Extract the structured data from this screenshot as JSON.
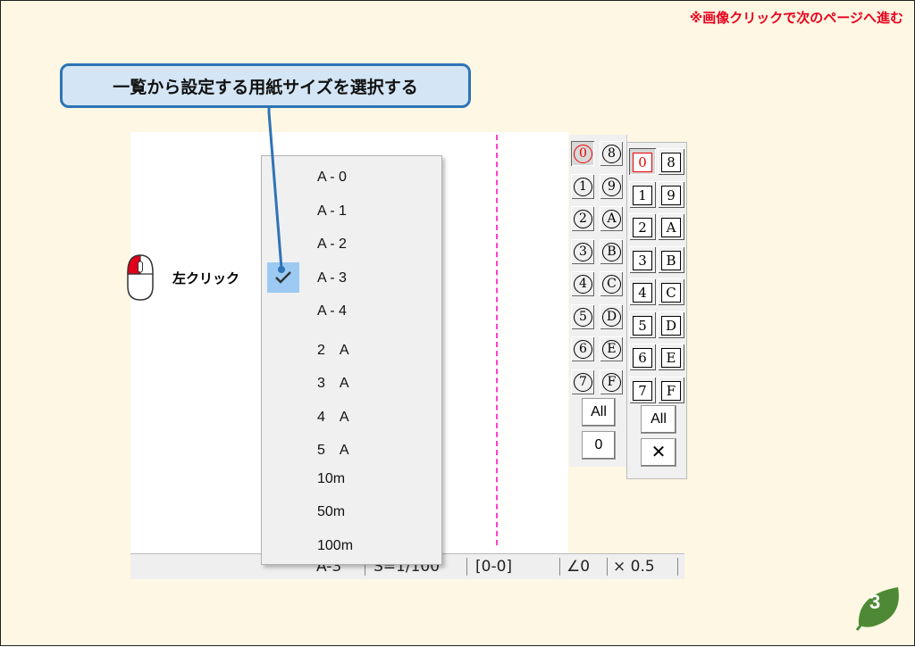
{
  "header": {
    "nav_note": "※画像クリックで次のページへ進む"
  },
  "callout": {
    "text": "一覧から設定する用紙サイズを選択する"
  },
  "hint": {
    "label": "左クリック",
    "icon": "mouse-left-click-icon"
  },
  "dropdown": {
    "selected": "A - 3",
    "items": [
      "A - 0",
      "A - 1",
      "A - 2",
      "A - 3",
      "A - 4",
      "2　A",
      "3　A",
      "4　A",
      "5　A",
      "10m",
      "50m",
      "100m"
    ]
  },
  "status_bar": {
    "paper": "A-3",
    "scale": "S=1/100",
    "range": "[0-0]",
    "angle": "∠0",
    "multiplier": "× 0.5"
  },
  "left_panel": {
    "col1": [
      "0",
      "1",
      "2",
      "3",
      "4",
      "5",
      "6",
      "7"
    ],
    "col2": [
      "8",
      "9",
      "A",
      "B",
      "C",
      "D",
      "E",
      "F"
    ],
    "all_label": "All",
    "zero_label": "0"
  },
  "right_panel": {
    "col1": [
      "0",
      "1",
      "2",
      "3",
      "4",
      "5",
      "6",
      "7"
    ],
    "col2": [
      "8",
      "9",
      "A",
      "B",
      "C",
      "D",
      "E",
      "F"
    ],
    "all_label": "All",
    "clear_label": "✕"
  },
  "page_number": "3",
  "colors": {
    "accent_red": "#e8001c",
    "callout_border": "#2e74b5",
    "callout_fill": "#d4e6f5",
    "badge_green": "#4e8a35",
    "divider_pink": "#ff3cd2"
  }
}
